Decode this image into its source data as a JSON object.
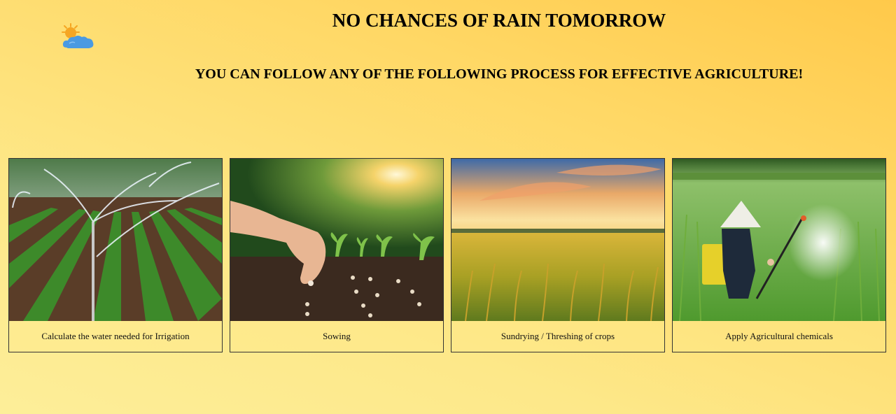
{
  "header": {
    "title": "NO CHANCES OF RAIN TOMORROW",
    "subtitle": "YOU CAN FOLLOW ANY OF THE FOLLOWING PROCESS FOR EFFECTIVE AGRICULTURE!",
    "weather_icon": "partly-cloudy-icon"
  },
  "cards": [
    {
      "caption": "Calculate the water needed for Irrigation",
      "image": "irrigation-sprinkler-field"
    },
    {
      "caption": "Sowing",
      "image": "hand-sowing-seeds"
    },
    {
      "caption": "Sundrying / Threshing of crops",
      "image": "golden-rice-field-sunset"
    },
    {
      "caption": "Apply Agricultural chemicals",
      "image": "farmer-spraying-crops"
    }
  ],
  "colors": {
    "background_top": "#ffc94a",
    "background_bottom": "#fdee99"
  }
}
